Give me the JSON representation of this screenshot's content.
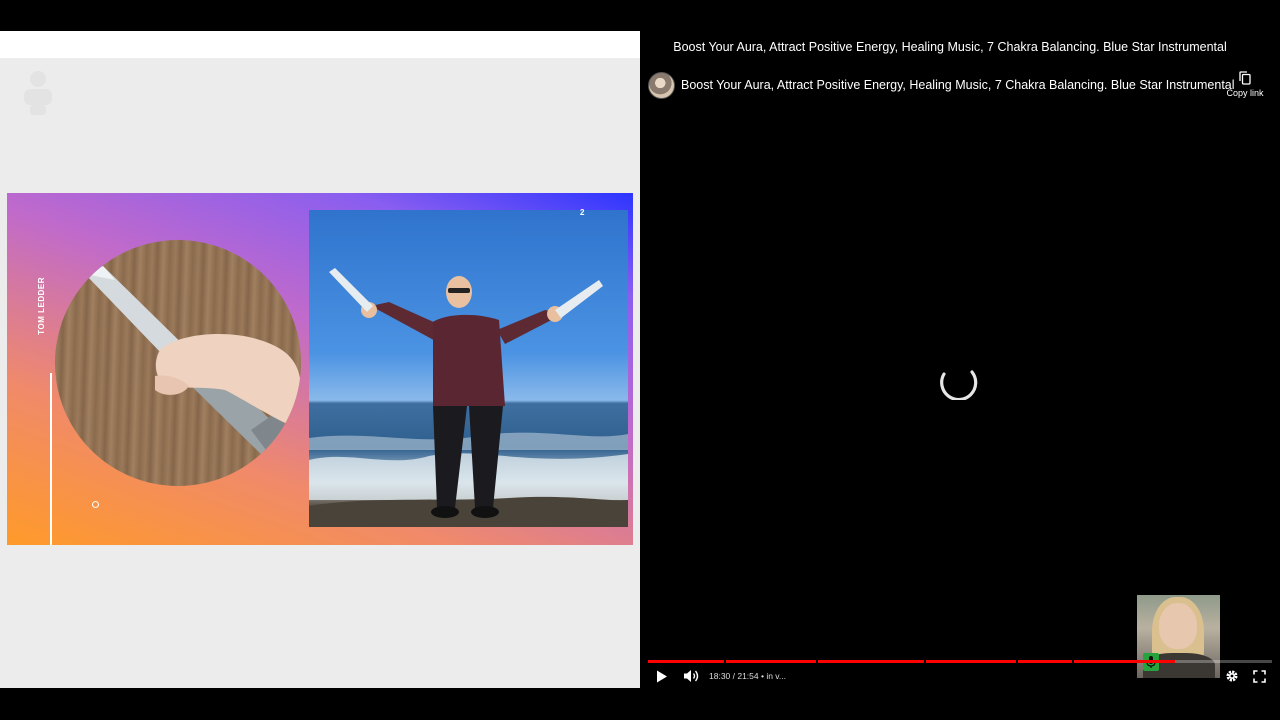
{
  "left_pane": {
    "slide": {
      "author": "TOM LEDDER",
      "page_number": "2"
    }
  },
  "player": {
    "window_title": "Boost Your Aura, Attract Positive Energy, Healing Music, 7 Chakra Balancing. Blue Star Instrumental",
    "video_title": "Boost Your Aura, Attract Positive Energy, Healing Music, 7 Chakra Balancing. Blue Star Instrumental",
    "copy_link_label": "Copy link",
    "time_display": "18:30 / 21:54 • in v...",
    "progress": {
      "current_seconds": 1110,
      "duration_seconds": 1314
    },
    "colors": {
      "progress": "#ff0000",
      "background": "#000000"
    },
    "icons": [
      "play-icon",
      "volume-icon",
      "settings-icon",
      "fullscreen-icon",
      "copy-icon",
      "loading-spinner-icon",
      "mic-icon"
    ]
  }
}
